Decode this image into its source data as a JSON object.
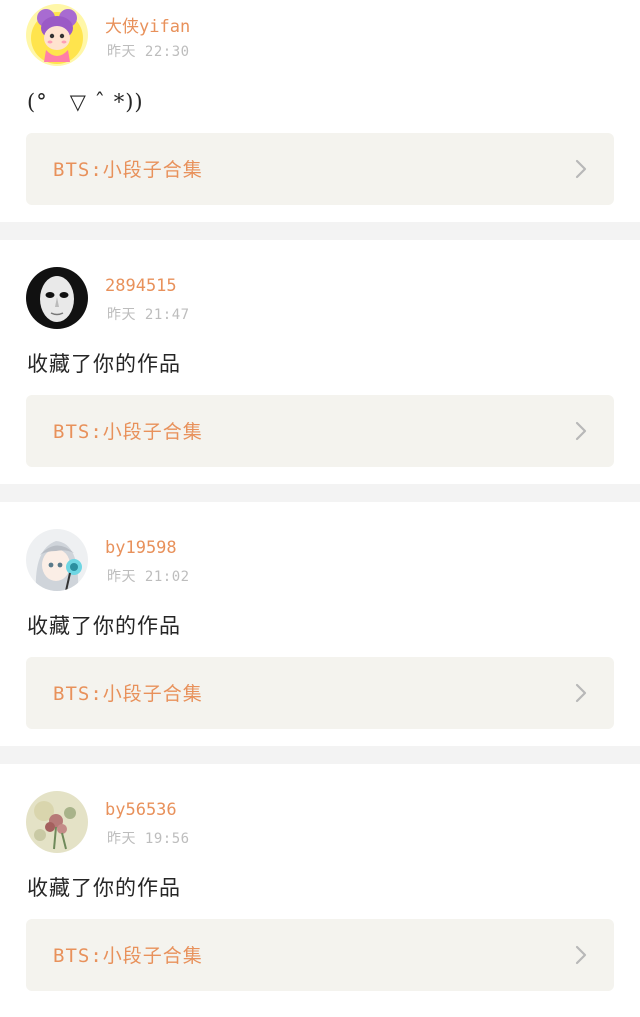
{
  "colors": {
    "accent": "#e8915b",
    "timestamp": "#bdbdbd",
    "card_bg": "#f4f3ee",
    "divider": "#f3f3f3"
  },
  "notifications": [
    {
      "username": "大侠yifan",
      "time": "昨天 22:30",
      "message": "(°　▽ ˆ *))",
      "work_title": "BTS:小段子合集",
      "avatar_icon": "cartoon-girl-avatar"
    },
    {
      "username": "2894515",
      "time": "昨天 21:47",
      "message": "收藏了你的作品",
      "work_title": "BTS:小段子合集",
      "avatar_icon": "mask-avatar"
    },
    {
      "username": "by19598",
      "time": "昨天 21:02",
      "message": "收藏了你的作品",
      "work_title": "BTS:小段子合集",
      "avatar_icon": "anime-headphones-avatar"
    },
    {
      "username": "by56536",
      "time": "昨天 19:56",
      "message": "收藏了你的作品",
      "work_title": "BTS:小段子合集",
      "avatar_icon": "flowers-avatar"
    }
  ]
}
